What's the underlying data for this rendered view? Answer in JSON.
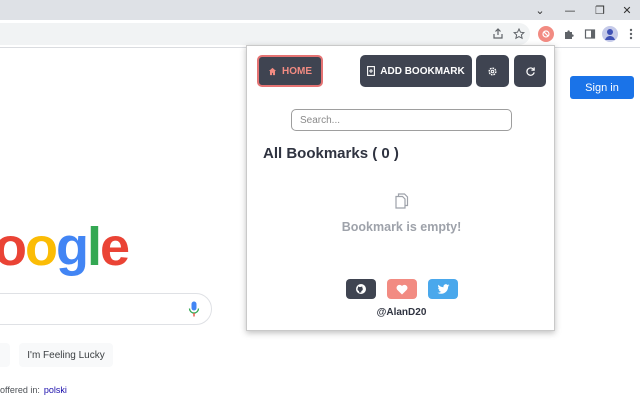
{
  "browser": {
    "window_controls": [
      "⌄",
      "—",
      "❐",
      "✕"
    ],
    "toolbar_icons": [
      "share-icon",
      "star-icon",
      "bookmark-ext-icon",
      "puzzle-icon",
      "sidepanel-icon",
      "profile-icon",
      "menu-icon"
    ]
  },
  "google": {
    "logo_letters": [
      "o",
      "o",
      "g",
      "l",
      "e"
    ],
    "lucky_button": "I'm Feeling Lucky",
    "offered_prefix": "offered in:",
    "offered_language": "polski",
    "sign_in": "Sign in"
  },
  "popup": {
    "home_label": "HOME",
    "add_bookmark_label": "ADD BOOKMARK",
    "search_placeholder": "Search...",
    "heading": "All Bookmarks ( 0 )",
    "empty_message": "Bookmark is empty!",
    "author_handle": "@AlanD20",
    "colors": {
      "button_bg": "#3f4451",
      "home_accent": "#f28b82",
      "heart_bg": "#f28b82",
      "twitter_bg": "#4aa8ec",
      "muted_text": "#9ea2aa"
    }
  }
}
